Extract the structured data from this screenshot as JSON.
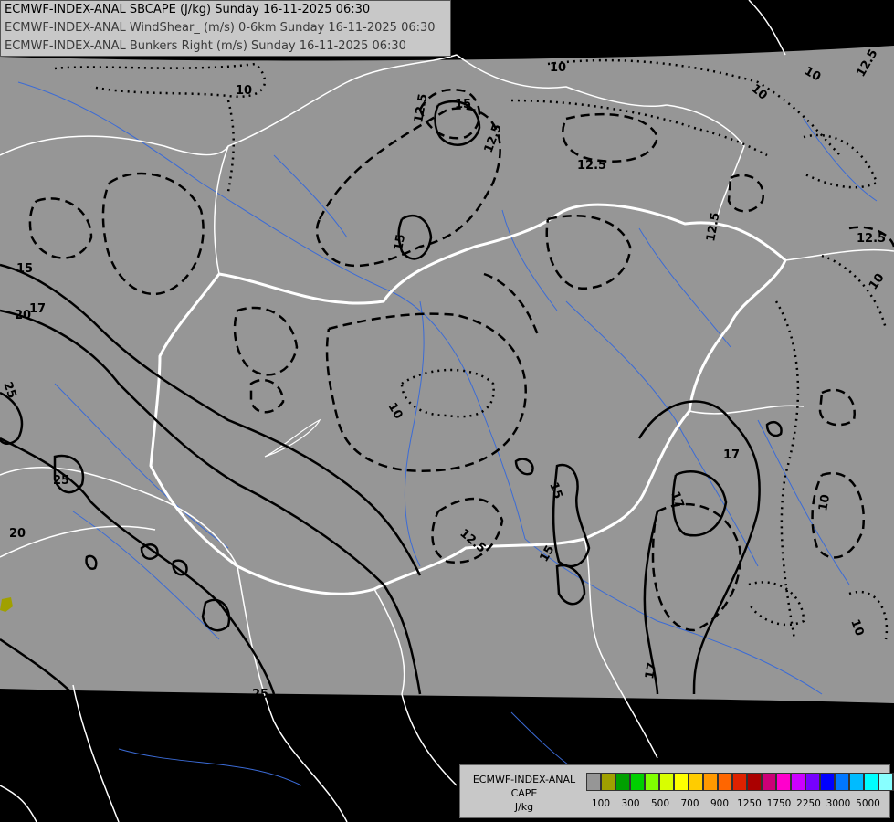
{
  "header": {
    "lines": [
      "ECMWF-INDEX-ANAL SBCAPE (J/kg) Sunday 16-11-2025 06:30",
      "ECMWF-INDEX-ANAL WindShear_ (m/s) 0-6km Sunday 16-11-2025 06:30",
      "ECMWF-INDEX-ANAL Bunkers Right (m/s) Sunday 16-11-2025 06:30"
    ]
  },
  "contour_labels": [
    {
      "text": "10"
    },
    {
      "text": "10"
    },
    {
      "text": "10"
    },
    {
      "text": "10"
    },
    {
      "text": "10"
    },
    {
      "text": "12.5"
    },
    {
      "text": "12.5"
    },
    {
      "text": "12.5"
    },
    {
      "text": "12.5"
    },
    {
      "text": "12.5"
    },
    {
      "text": "12.5"
    },
    {
      "text": "12.5"
    },
    {
      "text": "15"
    },
    {
      "text": "15"
    },
    {
      "text": "15"
    },
    {
      "text": "15"
    },
    {
      "text": "15"
    },
    {
      "text": "17"
    },
    {
      "text": "17"
    },
    {
      "text": "17"
    },
    {
      "text": "17"
    },
    {
      "text": "20"
    },
    {
      "text": "20"
    },
    {
      "text": "25"
    },
    {
      "text": "25"
    },
    {
      "text": "25"
    },
    {
      "text": "10"
    },
    {
      "text": "10"
    },
    {
      "text": "10"
    }
  ],
  "legend": {
    "title_lines": [
      "ECMWF-INDEX-ANAL",
      "CAPE",
      "J/kg"
    ],
    "colors": [
      "#969696",
      "#a0a000",
      "#00a000",
      "#00d000",
      "#80ff00",
      "#d8ff00",
      "#ffff00",
      "#ffcc00",
      "#ff9900",
      "#ff6600",
      "#dd2200",
      "#aa0000",
      "#cc0077",
      "#ff00cc",
      "#cc00ff",
      "#7700ff",
      "#0000ff",
      "#0077ff",
      "#00bbff",
      "#00ffff",
      "#88ffff",
      "#ffffff"
    ],
    "ticks": [
      "100",
      "300",
      "500",
      "700",
      "900",
      "1250",
      "1750",
      "2250",
      "3000",
      "5000"
    ]
  },
  "colors": {
    "background": "#000000",
    "domain": "#969696",
    "rivers": "#3b6bd6",
    "borders": "#ffffff",
    "contours": "#000000",
    "cape_low": "#a0a000"
  }
}
